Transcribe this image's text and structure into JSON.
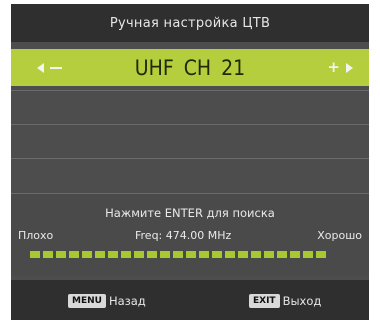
{
  "title": "Ручная настройка ЦТВ",
  "channel": {
    "band": "UHF",
    "ch_label": "CH",
    "number": "21",
    "left_icon": "arrow-left-minus-icon",
    "right_icon": "plus-arrow-right-icon"
  },
  "search": {
    "prompt": "Нажмите ENTER для поиска",
    "poor_label": "Плохо",
    "freq_label": "Freq: 474.00 MHz",
    "good_label": "Хорошо",
    "signal_level": 1.0,
    "signal_segments": 23
  },
  "footer": {
    "menu_key": "MENU",
    "back_label": "Назад",
    "exit_key": "EXIT",
    "exit_label": "Выход"
  },
  "colors": {
    "accent": "#b4ce3e",
    "panel": "#4d4d4d",
    "header": "#2f2f2f"
  }
}
